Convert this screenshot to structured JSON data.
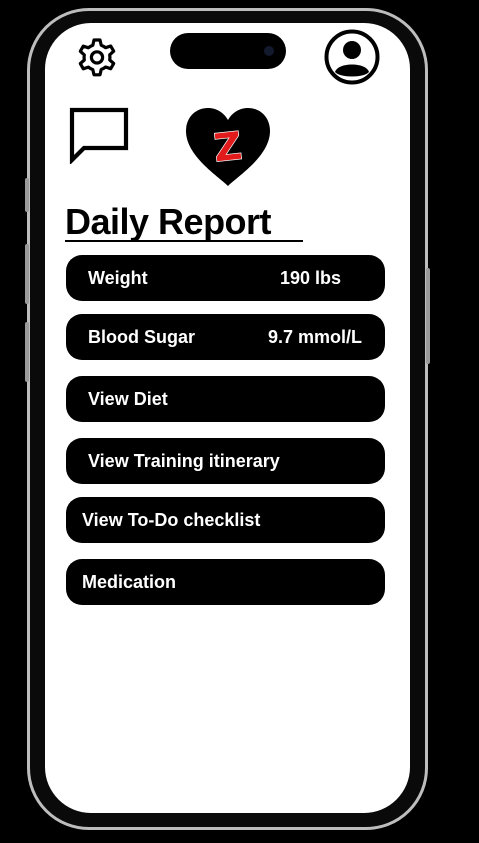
{
  "header": {
    "settings_icon": "gear-icon",
    "profile_icon": "user-circle-icon",
    "chat_icon": "chat-bubble-icon",
    "logo_icon": "heart-z-logo-icon",
    "logo_letter": "Z"
  },
  "page": {
    "title": "Daily Report"
  },
  "stats": [
    {
      "label": "Weight",
      "value": "190 lbs"
    },
    {
      "label": "Blood Sugar",
      "value": "9.7 mmol/L"
    }
  ],
  "actions": [
    {
      "label": "View Diet"
    },
    {
      "label": "View Training itinerary"
    },
    {
      "label": "View To-Do checklist"
    },
    {
      "label": "Medication"
    }
  ],
  "colors": {
    "background": "#000000",
    "screen": "#ffffff",
    "accent": "#e11b1b",
    "row": "#000000",
    "row_text": "#ffffff"
  }
}
